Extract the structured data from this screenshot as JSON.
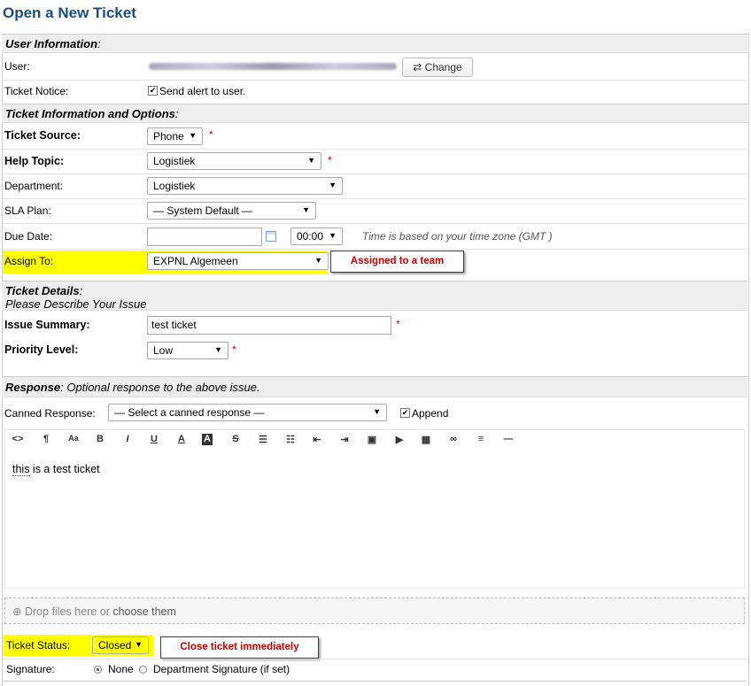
{
  "page_title": "Open a New Ticket",
  "user_info": {
    "section_label": "User Information",
    "user_label": "User:",
    "change_label": "Change",
    "notice_label": "Ticket Notice:",
    "notice_checkbox_label": "Send alert to user."
  },
  "ticket_info": {
    "section_label": "Ticket Information and Options",
    "source_label": "Ticket Source:",
    "source_value": "Phone",
    "help_topic_label": "Help Topic:",
    "help_topic_value": "Logistiek",
    "department_label": "Department:",
    "department_value": "Logistiek",
    "sla_label": "SLA Plan:",
    "sla_value": "— System Default —",
    "due_date_label": "Due Date:",
    "due_date_value": "",
    "due_time_value": "00:00",
    "timezone_note": "Time is based on your time zone (GMT )",
    "assign_label": "Assign To:",
    "assign_value": "EXPNL Algemeen",
    "assign_callout": "Assigned to a team"
  },
  "ticket_details": {
    "section_label": "Ticket Details",
    "section_sub": "Please Describe Your Issue",
    "summary_label": "Issue Summary:",
    "summary_value": "test ticket",
    "priority_label": "Priority Level:",
    "priority_value": "Low"
  },
  "response": {
    "section_label": "Response",
    "section_note": ": Optional response to the above issue.",
    "canned_label": "Canned Response:",
    "canned_value": "— Select a canned response —",
    "append_label": "Append",
    "body_text": "this is a test ticket",
    "drop_text": "Drop files here or",
    "choose_text": "choose them"
  },
  "footer": {
    "status_label": "Ticket Status:",
    "status_value": "Closed",
    "status_callout": "Close ticket immediately",
    "signature_label": "Signature:",
    "sig_none": "None",
    "sig_dept": "Department Signature (if set)"
  },
  "required_mark": "*",
  "colors": {
    "title": "#184E81",
    "highlight": "#ffff00",
    "callout": "#cc0000"
  }
}
